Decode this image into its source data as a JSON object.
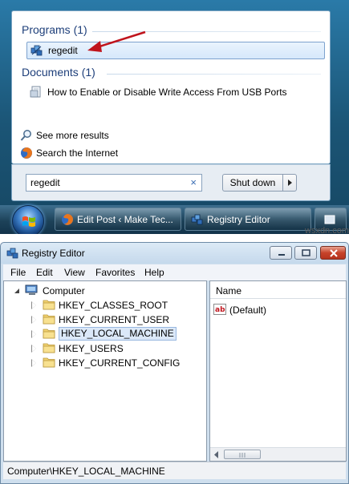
{
  "start_menu": {
    "programs_heading": "Programs (1)",
    "program_item": "regedit",
    "documents_heading": "Documents (1)",
    "document_item": "How to Enable or Disable Write Access From USB Ports",
    "see_more": "See more results",
    "search_internet": "Search the Internet",
    "search_value": "regedit",
    "clear_glyph": "×",
    "shutdown_label": "Shut down"
  },
  "taskbar": {
    "buttons": [
      {
        "label": "Edit Post ‹ Make Tec..."
      },
      {
        "label": "Registry Editor"
      }
    ]
  },
  "registry": {
    "title": "Registry Editor",
    "menu": [
      "File",
      "Edit",
      "View",
      "Favorites",
      "Help"
    ],
    "tree_root": "Computer",
    "tree_items": [
      "HKEY_CLASSES_ROOT",
      "HKEY_CURRENT_USER",
      "HKEY_LOCAL_MACHINE",
      "HKEY_USERS",
      "HKEY_CURRENT_CONFIG"
    ],
    "selected_item": "HKEY_LOCAL_MACHINE",
    "column_name": "Name",
    "value_default": "(Default)",
    "status": "Computer\\HKEY_LOCAL_MACHINE"
  },
  "watermark": "wsxdn.com",
  "colors": {
    "annotation_arrow": "#c0141c",
    "accent": "#1e3f7a"
  }
}
